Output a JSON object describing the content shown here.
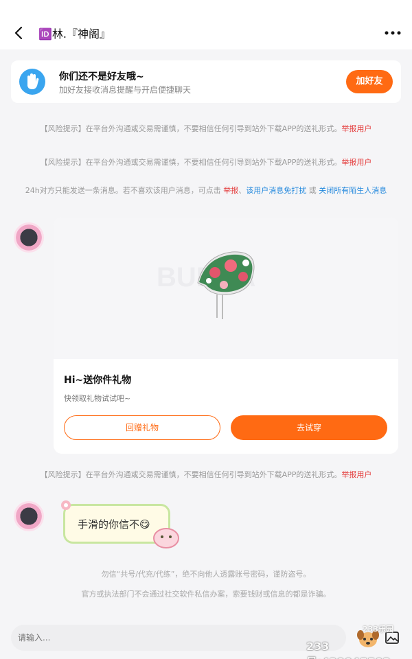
{
  "header": {
    "back_icon": "chevron-left-icon",
    "title": "🆔林.『神阁』",
    "more_icon": "more-dots-icon"
  },
  "friend_card": {
    "icon": "hand-wave-icon",
    "title": "你们还不是好友哦~",
    "subtitle": "加好友接收消息提醒与开启便捷聊天",
    "add_button": "加好友",
    "accent": "#ff6a13"
  },
  "risk_notices": [
    {
      "text": "【风险提示】在平台外沟通或交易需谨慎，不要相信任何引导到站外下载APP的送礼形式。",
      "link": "举报用户"
    },
    {
      "text": "【风险提示】在平台外沟通或交易需谨慎，不要相信任何引导到站外下载APP的送礼形式。",
      "link": "举报用户"
    },
    {
      "text": "【风险提示】在平台外沟通或交易需谨慎，不要相信任何引导到站外下载APP的送礼形式。",
      "link": "举报用户"
    }
  ],
  "limit_notice": {
    "text": "24h对方只能发送一条消息。若不喜欢该用户消息，可点击",
    "report": "举报",
    "sep": "、",
    "mute": "该用户消息免打扰",
    "or": "或",
    "close_strangers": "关闭所有陌生人消息"
  },
  "gift_card": {
    "title": "Hi~送你件礼物",
    "subtitle": "快领取礼物试试吧~",
    "return_button": "回赠礼物",
    "try_button": "去试穿"
  },
  "chat_message": {
    "text": "手滑的你信不",
    "emoji": "😋"
  },
  "footer_notes": [
    "勿信“共号/代充/代练”，绝不向他人透露账号密码，谨防盗号。",
    "官方或执法部门不会通过社交软件私信办案，索要钱财或信息的都是诈骗。"
  ],
  "input": {
    "placeholder": "请输入..."
  },
  "watermark": {
    "brand": "233乐园",
    "id": "233号:439045503"
  }
}
